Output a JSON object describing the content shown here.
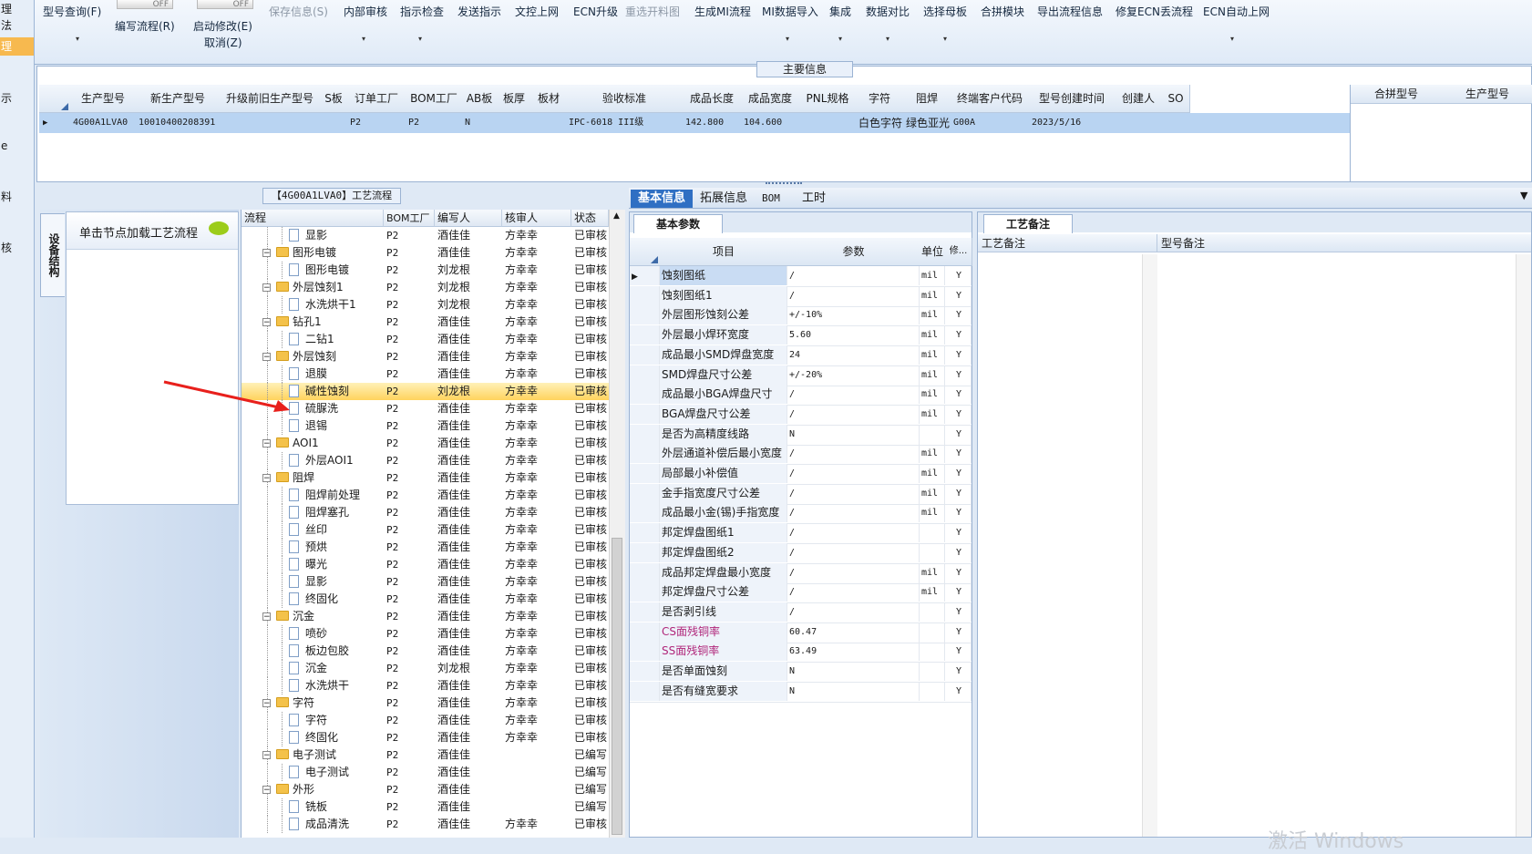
{
  "left_strip": {
    "items": [
      "理",
      "法",
      "理",
      "示",
      "e",
      "料",
      "核"
    ]
  },
  "ribbon": {
    "toggle_off": "OFF",
    "model_query": "型号查询(F)",
    "edit_flow": "编写流程(R)",
    "start_modify": "启动修改(E)",
    "cancel": "取消(Z)",
    "save_info": "保存信息(S)",
    "internal_review": "内部审核",
    "instruction_check": "指示检查",
    "send_instruction": "发送指示",
    "doc_upload": "文控上网",
    "ecn_upgrade": "ECN升级",
    "reselect_chart": "重选开料图",
    "gen_mi_flow": "生成MI流程",
    "mi_import": "MI数据导入",
    "integrate": "集成",
    "data_compare": "数据对比",
    "select_mother": "选择母板",
    "merge_module": "合拼模块",
    "export_flow": "导出流程信息",
    "fix_ecn": "修复ECN丢流程",
    "ecn_auto": "ECN自动上网"
  },
  "main_info": {
    "caption": "主要信息",
    "headers": [
      "生产型号",
      "新生产型号",
      "升级前旧生产型号",
      "S板",
      "订单工厂",
      "BOM工厂",
      "AB板",
      "板厚",
      "板材",
      "验收标准",
      "成品长度",
      "成品宽度",
      "PNL规格",
      "字符",
      "阻焊",
      "终端客户代码",
      "型号创建时间",
      "创建人",
      "SO"
    ],
    "row": [
      "4G00A1LVA0",
      "10010400208391",
      "",
      "",
      "P2",
      "P2",
      "N",
      "",
      "",
      "IPC-6018 III级",
      "142.800",
      "104.600",
      "",
      "白色字符",
      "绿色亚光",
      "G00A",
      "2023/5/16",
      "",
      ""
    ],
    "side_headers": [
      "合拼型号",
      "生产型号"
    ]
  },
  "process": {
    "caption": "【4G00A1LVA0】工艺流程",
    "vtab": "设备结构",
    "nav_hint": "单击节点加载工艺流程",
    "headers": [
      "流程",
      "BOM工厂",
      "编写人",
      "核审人",
      "状态"
    ],
    "rows": [
      {
        "name": "显影",
        "type": "doc",
        "bom": "P2",
        "writer": "酒佳佳",
        "reviewer": "方幸幸",
        "status": "已审核"
      },
      {
        "name": "图形电镀",
        "type": "folder",
        "bom": "P2",
        "writer": "酒佳佳",
        "reviewer": "方幸幸",
        "status": "已审核"
      },
      {
        "name": "图形电镀",
        "type": "doc",
        "bom": "P2",
        "writer": "刘龙根",
        "reviewer": "方幸幸",
        "status": "已审核"
      },
      {
        "name": "外层蚀刻1",
        "type": "folder",
        "bom": "P2",
        "writer": "刘龙根",
        "reviewer": "方幸幸",
        "status": "已审核"
      },
      {
        "name": "水洗烘干1",
        "type": "doc",
        "bom": "P2",
        "writer": "刘龙根",
        "reviewer": "方幸幸",
        "status": "已审核"
      },
      {
        "name": "钻孔1",
        "type": "folder",
        "bom": "P2",
        "writer": "酒佳佳",
        "reviewer": "方幸幸",
        "status": "已审核"
      },
      {
        "name": "二钻1",
        "type": "doc",
        "bom": "P2",
        "writer": "酒佳佳",
        "reviewer": "方幸幸",
        "status": "已审核"
      },
      {
        "name": "外层蚀刻",
        "type": "folder",
        "bom": "P2",
        "writer": "酒佳佳",
        "reviewer": "方幸幸",
        "status": "已审核"
      },
      {
        "name": "退膜",
        "type": "doc",
        "bom": "P2",
        "writer": "酒佳佳",
        "reviewer": "方幸幸",
        "status": "已审核"
      },
      {
        "name": "碱性蚀刻",
        "type": "doc",
        "bom": "P2",
        "writer": "刘龙根",
        "reviewer": "方幸幸",
        "status": "已审核",
        "selected": true
      },
      {
        "name": "硫脲洗",
        "type": "doc",
        "bom": "P2",
        "writer": "酒佳佳",
        "reviewer": "方幸幸",
        "status": "已审核"
      },
      {
        "name": "退锡",
        "type": "doc",
        "bom": "P2",
        "writer": "酒佳佳",
        "reviewer": "方幸幸",
        "status": "已审核"
      },
      {
        "name": "AOI1",
        "type": "folder",
        "bom": "P2",
        "writer": "酒佳佳",
        "reviewer": "方幸幸",
        "status": "已审核"
      },
      {
        "name": "外层AOI1",
        "type": "doc",
        "bom": "P2",
        "writer": "酒佳佳",
        "reviewer": "方幸幸",
        "status": "已审核"
      },
      {
        "name": "阻焊",
        "type": "folder",
        "bom": "P2",
        "writer": "酒佳佳",
        "reviewer": "方幸幸",
        "status": "已审核"
      },
      {
        "name": "阻焊前处理",
        "type": "doc",
        "bom": "P2",
        "writer": "酒佳佳",
        "reviewer": "方幸幸",
        "status": "已审核"
      },
      {
        "name": "阻焊塞孔",
        "type": "doc",
        "bom": "P2",
        "writer": "酒佳佳",
        "reviewer": "方幸幸",
        "status": "已审核"
      },
      {
        "name": "丝印",
        "type": "doc",
        "bom": "P2",
        "writer": "酒佳佳",
        "reviewer": "方幸幸",
        "status": "已审核"
      },
      {
        "name": "预烘",
        "type": "doc",
        "bom": "P2",
        "writer": "酒佳佳",
        "reviewer": "方幸幸",
        "status": "已审核"
      },
      {
        "name": "曝光",
        "type": "doc",
        "bom": "P2",
        "writer": "酒佳佳",
        "reviewer": "方幸幸",
        "status": "已审核"
      },
      {
        "name": "显影",
        "type": "doc",
        "bom": "P2",
        "writer": "酒佳佳",
        "reviewer": "方幸幸",
        "status": "已审核"
      },
      {
        "name": "终固化",
        "type": "doc",
        "bom": "P2",
        "writer": "酒佳佳",
        "reviewer": "方幸幸",
        "status": "已审核"
      },
      {
        "name": "沉金",
        "type": "folder",
        "bom": "P2",
        "writer": "酒佳佳",
        "reviewer": "方幸幸",
        "status": "已审核"
      },
      {
        "name": "喷砂",
        "type": "doc",
        "bom": "P2",
        "writer": "酒佳佳",
        "reviewer": "方幸幸",
        "status": "已审核"
      },
      {
        "name": "板边包胶",
        "type": "doc",
        "bom": "P2",
        "writer": "酒佳佳",
        "reviewer": "方幸幸",
        "status": "已审核"
      },
      {
        "name": "沉金",
        "type": "doc",
        "bom": "P2",
        "writer": "刘龙根",
        "reviewer": "方幸幸",
        "status": "已审核"
      },
      {
        "name": "水洗烘干",
        "type": "doc",
        "bom": "P2",
        "writer": "酒佳佳",
        "reviewer": "方幸幸",
        "status": "已审核"
      },
      {
        "name": "字符",
        "type": "folder",
        "bom": "P2",
        "writer": "酒佳佳",
        "reviewer": "方幸幸",
        "status": "已审核"
      },
      {
        "name": "字符",
        "type": "doc",
        "bom": "P2",
        "writer": "酒佳佳",
        "reviewer": "方幸幸",
        "status": "已审核"
      },
      {
        "name": "终固化",
        "type": "doc",
        "bom": "P2",
        "writer": "酒佳佳",
        "reviewer": "方幸幸",
        "status": "已审核"
      },
      {
        "name": "电子测试",
        "type": "folder",
        "bom": "P2",
        "writer": "酒佳佳",
        "reviewer": "",
        "status": "已编写"
      },
      {
        "name": "电子测试",
        "type": "doc",
        "bom": "P2",
        "writer": "酒佳佳",
        "reviewer": "",
        "status": "已编写"
      },
      {
        "name": "外形",
        "type": "folder",
        "bom": "P2",
        "writer": "酒佳佳",
        "reviewer": "",
        "status": "已编写"
      },
      {
        "name": "铣板",
        "type": "doc",
        "bom": "P2",
        "writer": "酒佳佳",
        "reviewer": "",
        "status": "已编写"
      },
      {
        "name": "成品清洗",
        "type": "doc",
        "bom": "P2",
        "writer": "酒佳佳",
        "reviewer": "方幸幸",
        "status": "已审核"
      }
    ]
  },
  "tabs": [
    "基本信息",
    "拓展信息",
    "BOM",
    "工时"
  ],
  "basic": {
    "caption": "基本参数",
    "headers": [
      "项目",
      "参数",
      "单位",
      "修..."
    ],
    "rows": [
      {
        "item": "蚀刻图纸",
        "param": "/",
        "unit": "mil",
        "flag": "Y",
        "color": ""
      },
      {
        "item": "蚀刻图纸1",
        "param": "/",
        "unit": "mil",
        "flag": "Y",
        "color": ""
      },
      {
        "item": "外层图形蚀刻公差",
        "param": "+/-10%",
        "unit": "mil",
        "flag": "Y",
        "color": ""
      },
      {
        "item": "外层最小焊环宽度",
        "param": "5.60",
        "unit": "mil",
        "flag": "Y",
        "color": ""
      },
      {
        "item": "成品最小SMD焊盘宽度",
        "param": "24",
        "unit": "mil",
        "flag": "Y",
        "color": ""
      },
      {
        "item": "SMD焊盘尺寸公差",
        "param": "+/-20%",
        "unit": "mil",
        "flag": "Y",
        "color": ""
      },
      {
        "item": "成品最小BGA焊盘尺寸",
        "param": "/",
        "unit": "mil",
        "flag": "Y",
        "color": ""
      },
      {
        "item": "BGA焊盘尺寸公差",
        "param": "/",
        "unit": "mil",
        "flag": "Y",
        "color": ""
      },
      {
        "item": "是否为高精度线路",
        "param": "N",
        "unit": "",
        "flag": "Y",
        "color": ""
      },
      {
        "item": "外层通道补偿后最小宽度",
        "param": "/",
        "unit": "mil",
        "flag": "Y",
        "color": ""
      },
      {
        "item": "局部最小补偿值",
        "param": "/",
        "unit": "mil",
        "flag": "Y",
        "color": ""
      },
      {
        "item": "金手指宽度尺寸公差",
        "param": "/",
        "unit": "mil",
        "flag": "Y",
        "color": ""
      },
      {
        "item": "成品最小金(锡)手指宽度",
        "param": "/",
        "unit": "mil",
        "flag": "Y",
        "color": ""
      },
      {
        "item": "邦定焊盘图纸1",
        "param": "/",
        "unit": "",
        "flag": "Y",
        "color": ""
      },
      {
        "item": "邦定焊盘图纸2",
        "param": "/",
        "unit": "",
        "flag": "Y",
        "color": ""
      },
      {
        "item": "成品邦定焊盘最小宽度",
        "param": "/",
        "unit": "mil",
        "flag": "Y",
        "color": ""
      },
      {
        "item": "邦定焊盘尺寸公差",
        "param": "/",
        "unit": "mil",
        "flag": "Y",
        "color": ""
      },
      {
        "item": "是否剥引线",
        "param": "/",
        "unit": "",
        "flag": "Y",
        "color": ""
      },
      {
        "item": "CS面残铜率",
        "param": "60.47",
        "unit": "",
        "flag": "Y",
        "color": "#b0267a"
      },
      {
        "item": "SS面残铜率",
        "param": "63.49",
        "unit": "",
        "flag": "Y",
        "color": "#b0267a"
      },
      {
        "item": "是否单面蚀刻",
        "param": "N",
        "unit": "",
        "flag": "Y",
        "color": ""
      },
      {
        "item": "是否有缝宽要求",
        "param": "N",
        "unit": "",
        "flag": "Y",
        "color": ""
      }
    ]
  },
  "notes": {
    "caption": "工艺备注",
    "col1": "工艺备注",
    "col2": "型号备注",
    "watermark": "激活 Windows"
  },
  "colors": {
    "selected_row": "#ffd35e",
    "active_tab": "#2f6fc3",
    "arrow": "#e8201c",
    "magenta_text": "#b0267a"
  }
}
